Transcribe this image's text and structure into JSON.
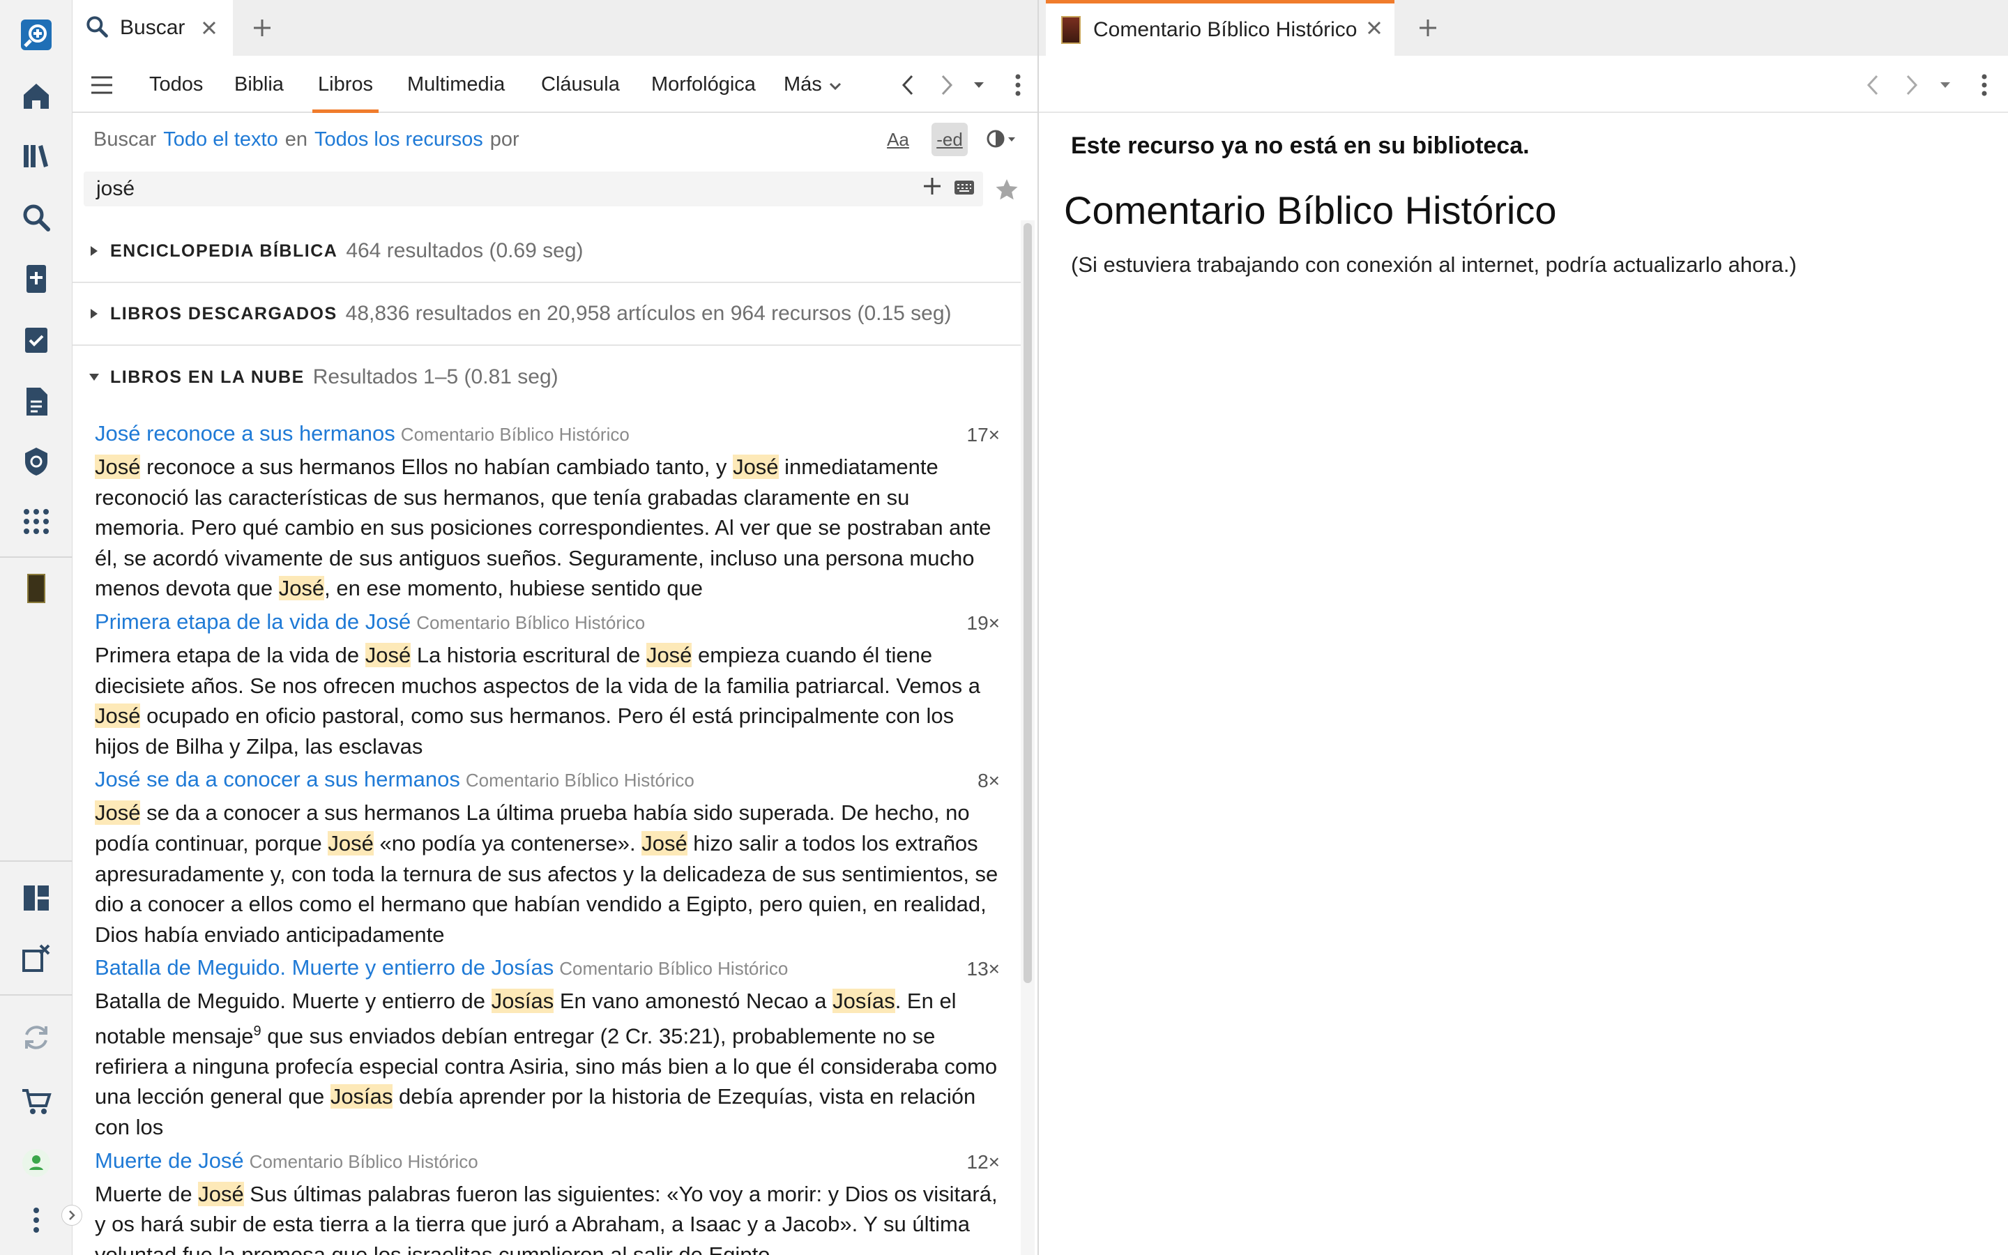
{
  "left_tab": {
    "title": "Buscar"
  },
  "filters": {
    "tabs": [
      "Todos",
      "Biblia",
      "Libros",
      "Multimedia",
      "Cláusula",
      "Morfológica"
    ],
    "more": "Más",
    "active": "Libros"
  },
  "query": {
    "buscar": "Buscar",
    "scope": "Todo el texto",
    "en": "en",
    "resources": "Todos los recursos",
    "por": "por",
    "case_btn": "Aa",
    "ed_btn": "-ed",
    "text": "josé"
  },
  "sections": [
    {
      "title": "ENCICLOPEDIA BÍBLICA",
      "count": "464 resultados (0.69 seg)",
      "expanded": false
    },
    {
      "title": "LIBROS DESCARGADOS",
      "count": "48,836 resultados en 20,958 artículos en 964 recursos (0.15 seg)",
      "expanded": false
    },
    {
      "title": "LIBROS EN LA NUBE",
      "count": "Resultados 1–5 (0.81 seg)",
      "expanded": true
    }
  ],
  "hits": [
    {
      "title": "José reconoce a sus hermanos",
      "source": "Comentario Bíblico Histórico",
      "count": "17×",
      "body": [
        {
          "t": "José",
          "h": true
        },
        {
          "t": " reconoce a sus hermanos Ellos no habían cambiado tanto, y "
        },
        {
          "t": "José",
          "h": true
        },
        {
          "t": " inmediatamente reconoció las características de sus hermanos, que tenía grabadas claramente en su memoria. Pero qué cambio en sus posiciones correspondientes. Al ver que se postraban ante él, se acordó vivamente de sus antiguos sueños. Seguramente, incluso una persona mucho menos devota que "
        },
        {
          "t": "José",
          "h": true
        },
        {
          "t": ", en ese momento, hubiese sentido que"
        }
      ]
    },
    {
      "title": "Primera etapa de la vida de José",
      "source": "Comentario Bíblico Histórico",
      "count": "19×",
      "body": [
        {
          "t": "Primera etapa de la vida de "
        },
        {
          "t": "José",
          "h": true
        },
        {
          "t": " La historia escritural de "
        },
        {
          "t": "José",
          "h": true
        },
        {
          "t": " empieza cuando él tiene diecisiete años. Se nos ofrecen muchos aspectos de la vida de la familia patriarcal. Vemos a "
        },
        {
          "t": "José",
          "h": true
        },
        {
          "t": " ocupado en oficio pastoral, como sus hermanos. Pero él está principalmente con los hijos de Bilha y Zilpa, las esclavas"
        }
      ]
    },
    {
      "title": "José se da a conocer a sus hermanos",
      "source": "Comentario Bíblico Histórico",
      "count": "8×",
      "body": [
        {
          "t": "José",
          "h": true
        },
        {
          "t": " se da a conocer a sus hermanos La última prueba había sido superada. De hecho, no podía continuar, porque "
        },
        {
          "t": "José",
          "h": true
        },
        {
          "t": " «no podía ya contenerse». "
        },
        {
          "t": "José",
          "h": true
        },
        {
          "t": " hizo salir a todos los extraños apresuradamente y, con toda la ternura de sus afectos y la delicadeza de sus sentimientos, se dio a conocer a ellos como el hermano que habían vendido a Egipto, pero quien, en realidad, Dios había enviado anticipadamente"
        }
      ]
    },
    {
      "title": "Batalla de Meguido. Muerte y entierro de Josías",
      "source": "Comentario Bíblico Histórico",
      "count": "13×",
      "body": [
        {
          "t": "Batalla de Meguido. Muerte y entierro de "
        },
        {
          "t": "Josías",
          "h": true
        },
        {
          "t": " En vano amonestó Necao a "
        },
        {
          "t": "Josías",
          "h": true
        },
        {
          "t": ". En el notable mensaje"
        },
        {
          "t": "9",
          "sup": true
        },
        {
          "t": " que sus enviados debían entregar (2 Cr. 35:21), probablemente no se refiriera a ninguna profecía especial contra Asiria, sino más bien a lo que él consideraba como una lección general que "
        },
        {
          "t": "Josías",
          "h": true
        },
        {
          "t": " debía aprender por la historia de Ezequías, vista en relación con los"
        }
      ]
    },
    {
      "title": "Muerte de José",
      "source": "Comentario Bíblico Histórico",
      "count": "12×",
      "body": [
        {
          "t": "Muerte de "
        },
        {
          "t": "José",
          "h": true
        },
        {
          "t": " Sus últimas palabras fueron las siguientes: «Yo voy a morir: y Dios os visitará, y os hará subir de esta tierra a la tierra que juró a Abraham, a Isaac y a Jacob». Y su última voluntad fue la promesa que los israelitas cumplieron al salir de Egipto"
        }
      ]
    }
  ],
  "right": {
    "tab_title": "Comentario Bíblico Histórico",
    "notice": "Este recurso ya no está en su biblioteca.",
    "resource_title": "Comentario Bíblico Histórico",
    "note": "(Si estuviera trabajando con conexión al internet, podría actualizarlo ahora.)"
  },
  "colors": {
    "accent": "#f07c2c",
    "link": "#1f7ad6",
    "highlight": "#fde9b8",
    "rail_icon": "#2f4a66"
  }
}
